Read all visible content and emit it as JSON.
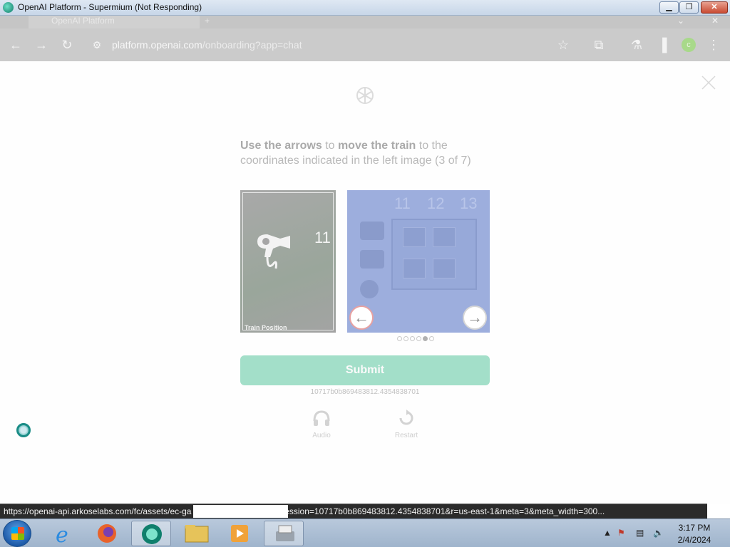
{
  "window": {
    "title": "OpenAI Platform - Supermium (Not Responding)",
    "min_label": "▁",
    "max_label": "❐",
    "close_label": "✕"
  },
  "browser": {
    "tab_title": "OpenAI Platform",
    "new_tab_label": "+",
    "tabstrip_right_a": "⌄",
    "tabstrip_right_b": "✕",
    "url_host": "platform.openai.com",
    "url_path": "/onboarding?app=chat",
    "profile_initial": "c"
  },
  "challenge": {
    "instruction_b1": "Use the arrows",
    "instruction_t1": " to ",
    "instruction_b2": "move the train",
    "instruction_t2": " to the coordinates indicated in the left image (3 of 7)",
    "train_position_label": "Train Position",
    "left_coordinate": "11",
    "column_labels": [
      "11",
      "12",
      "13"
    ],
    "arrow_left": "←",
    "arrow_right": "→",
    "dots_total": 6,
    "dots_active": 5,
    "submit_label": "Submit",
    "session_id": "10717b0b869483812.4354838701",
    "audio_label": "Audio",
    "restart_label": "Restart"
  },
  "statusbar": {
    "url": "https://openai-api.arkoselabs.com/fc/assets/ec-ga                                          0/standard/index.html?session=10717b0b869483812.4354838701&r=us-east-1&meta=3&meta_width=300..."
  },
  "taskbar": {
    "time": "3:17 PM",
    "date": "2/4/2024",
    "tray_up": "▲"
  },
  "colors": {
    "accent": "#a3dfc9",
    "right_panel": "#9daedd"
  }
}
